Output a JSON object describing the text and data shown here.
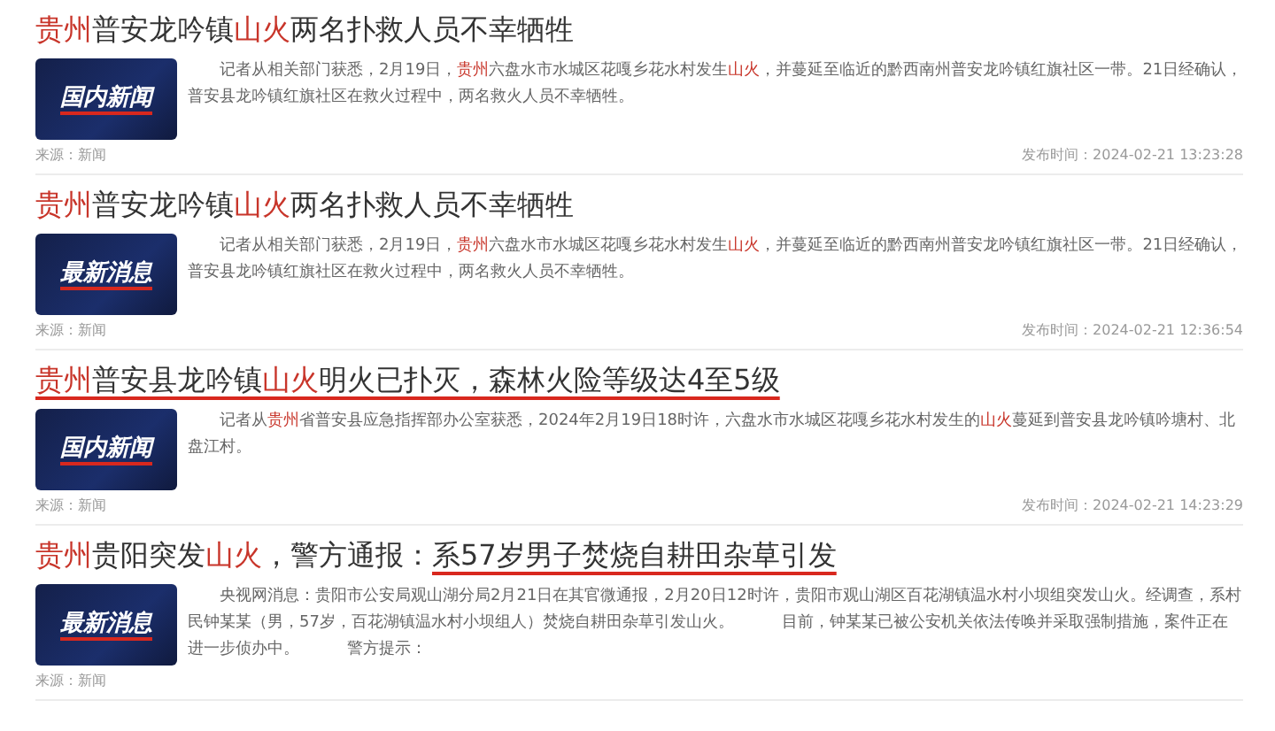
{
  "articles": [
    {
      "title": [
        {
          "text": "贵州",
          "highlight": true,
          "underlined": false
        },
        {
          "text": "普安龙吟镇",
          "highlight": false,
          "underlined": false
        },
        {
          "text": "山火",
          "highlight": true,
          "underlined": false
        },
        {
          "text": "两名扑救人员不幸牺牲",
          "highlight": false,
          "underlined": false
        }
      ],
      "thumb_label": "国内新闻",
      "body": [
        {
          "text": "　　记者从相关部门获悉，2月19日，",
          "highlight": false
        },
        {
          "text": "贵州",
          "highlight": true
        },
        {
          "text": "六盘水市水城区花嘎乡花水村发生",
          "highlight": false
        },
        {
          "text": "山火",
          "highlight": true
        },
        {
          "text": "，并蔓延至临近的黔西南州普安龙吟镇红旗社区一带。21日经确认，普安县龙吟镇红旗社区在救火过程中，两名救火人员不幸牺牲。",
          "highlight": false
        }
      ],
      "source": "来源：新闻",
      "published": "发布时间：2024-02-21 13:23:28"
    },
    {
      "title": [
        {
          "text": "贵州",
          "highlight": true,
          "underlined": false
        },
        {
          "text": "普安龙吟镇",
          "highlight": false,
          "underlined": false
        },
        {
          "text": "山火",
          "highlight": true,
          "underlined": false
        },
        {
          "text": "两名扑救人员不幸牺牲",
          "highlight": false,
          "underlined": false
        }
      ],
      "thumb_label": "最新消息",
      "body": [
        {
          "text": "　　记者从相关部门获悉，2月19日，",
          "highlight": false
        },
        {
          "text": "贵州",
          "highlight": true
        },
        {
          "text": "六盘水市水城区花嘎乡花水村发生",
          "highlight": false
        },
        {
          "text": "山火",
          "highlight": true
        },
        {
          "text": "，并蔓延至临近的黔西南州普安龙吟镇红旗社区一带。21日经确认，普安县龙吟镇红旗社区在救火过程中，两名救火人员不幸牺牲。",
          "highlight": false
        }
      ],
      "source": "来源：新闻",
      "published": "发布时间：2024-02-21 12:36:54"
    },
    {
      "title": [
        {
          "text": "贵州",
          "highlight": true,
          "underlined": true
        },
        {
          "text": "普安县龙吟镇",
          "highlight": false,
          "underlined": true
        },
        {
          "text": "山火",
          "highlight": true,
          "underlined": true
        },
        {
          "text": "明火已扑灭，森林火险等级达4至5级",
          "highlight": false,
          "underlined": true
        }
      ],
      "thumb_label": "国内新闻",
      "body": [
        {
          "text": "　　记者从",
          "highlight": false
        },
        {
          "text": "贵州",
          "highlight": true
        },
        {
          "text": "省普安县应急指挥部办公室获悉，2024年2月19日18时许，六盘水市水城区花嘎乡花水村发生的",
          "highlight": false
        },
        {
          "text": "山火",
          "highlight": true
        },
        {
          "text": "蔓延到普安县龙吟镇吟塘村、北盘江村。",
          "highlight": false
        }
      ],
      "source": "来源：新闻",
      "published": "发布时间：2024-02-21 14:23:29"
    },
    {
      "title": [
        {
          "text": "贵州",
          "highlight": true,
          "underlined": false
        },
        {
          "text": "贵阳突发",
          "highlight": false,
          "underlined": false
        },
        {
          "text": "山火",
          "highlight": true,
          "underlined": false
        },
        {
          "text": "，警方通报：",
          "highlight": false,
          "underlined": false
        },
        {
          "text": "系57岁男子焚烧自耕田杂草引发",
          "highlight": false,
          "underlined": true
        }
      ],
      "thumb_label": "最新消息",
      "body": [
        {
          "text": "　　央视网消息：贵阳市公安局观山湖分局2月21日在其官微通报，2月20日12时许，贵阳市观山湖区百花湖镇温水村小坝组突发山火。经调查，系村民钟某某（男，57岁，百花湖镇温水村小坝组人）焚烧自耕田杂草引发山火。　　　目前，钟某某已被公安机关依法传唤并采取强制措施，案件正在进一步侦办中。　　　警方提示：",
          "highlight": false
        }
      ],
      "source": "来源：新闻"
    }
  ]
}
